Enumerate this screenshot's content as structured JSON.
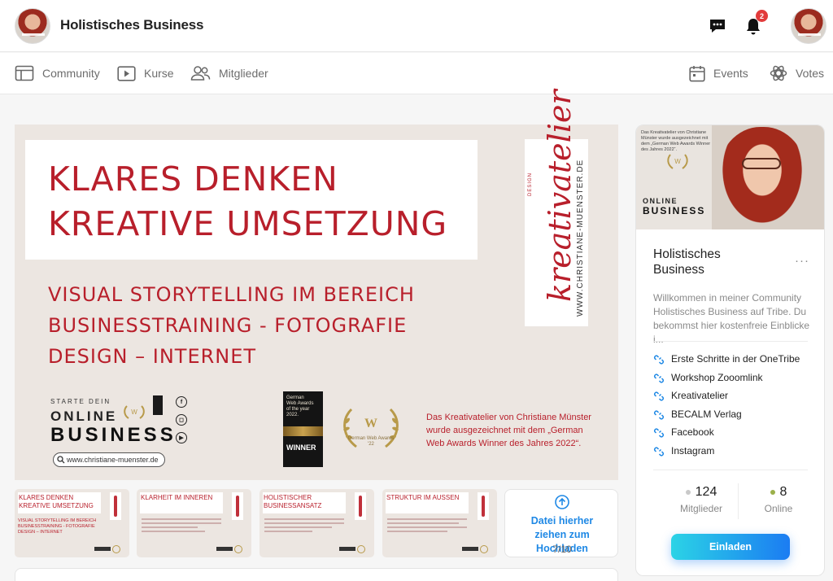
{
  "header": {
    "title": "Holistisches Business",
    "notification_count": "2",
    "icons": [
      "community-avatar",
      "chat-icon",
      "bell-icon",
      "user-avatar"
    ]
  },
  "nav": {
    "left": [
      {
        "label": "Community",
        "icon": "community-icon"
      },
      {
        "label": "Kurse",
        "icon": "play-icon"
      },
      {
        "label": "Mitglieder",
        "icon": "members-icon"
      }
    ],
    "right": [
      {
        "label": "Events",
        "icon": "calendar-icon"
      },
      {
        "label": "Votes",
        "icon": "votes-icon"
      }
    ]
  },
  "banner": {
    "title_line1": "KLARES DENKEN",
    "title_line2": "KREATIVE UMSETZUNG",
    "sub_line1": "VISUAL STORYTELLING IM BEREICH",
    "sub_line2": "BUSINESSTRAINING - FOTOGRAFIE",
    "sub_line3": "DESIGN – INTERNET",
    "logo_text": "kreativatelier",
    "logo_prefix": "DESIGN",
    "logo_url": "WWW.CHRISTIANE-MUENSTER.DE",
    "starte": "STARTE DEIN",
    "online": "ONLINE",
    "business": "BUSINESS",
    "url": "www.christiane-muenster.de",
    "gwa_line1": "German",
    "gwa_line2": "Web Awards",
    "gwa_line3": "of the year",
    "gwa_line4": "2022.",
    "gwa_winner": "WINNER",
    "laurel_label": "German Web Awards '22",
    "award_note_line1": "Das Kreativatelier von Christiane Münster",
    "award_note_line2": "wurde ausgezeichnet mit dem „German",
    "award_note_line3": "Web Awards Winner des Jahres 2022“."
  },
  "thumbnails": [
    {
      "title": "KLARES DENKEN KREATIVE UMSETZUNG",
      "sub": "VISUAL STORYTELLING IM BEREICH BUSINESSTRAINING - FOTOGRAFIE DESIGN – INTERNET"
    },
    {
      "title": "KLARHEIT IM INNEREN"
    },
    {
      "title": "HOLISTISCHER BUSINESSANSATZ"
    },
    {
      "title": "STRUKTUR IM AUSSEN"
    }
  ],
  "upload": {
    "label": "Datei hierher ziehen zum Hochladen",
    "count": "7/10"
  },
  "sidebar": {
    "name_line1": "Holistisches",
    "name_line2": "Business",
    "more": "···",
    "description": "Willkommen in meiner Community Holistisches Business auf Tribe. Du bekommst hier kostenfreie Einblicke i...",
    "image_caption": "Das Kreativatelier von Christiane Münster wurde ausgezeichnet mit dem „German Web Awards Winner des Jahres 2022“.",
    "image_online": "ONLINE",
    "image_business": "BUSINESS",
    "links": [
      {
        "label": "Erste Schritte in der OneTribe",
        "icon": "link-icon"
      },
      {
        "label": "Workshop Zooomlink",
        "icon": "link-icon"
      },
      {
        "label": "Kreativatelier",
        "icon": "link-icon"
      },
      {
        "label": "BECALM Verlag",
        "icon": "link-icon"
      },
      {
        "label": "Facebook",
        "icon": "link-icon"
      },
      {
        "label": "Instagram",
        "icon": "link-icon"
      }
    ],
    "stats": {
      "members_count": "124",
      "members_label": "Mitglieder",
      "online_count": "8",
      "online_label": "Online"
    },
    "invite_label": "Einladen"
  },
  "colors": {
    "brand_red": "#b81f2b",
    "link_blue": "#1e88e5",
    "badge_red": "#e23b3b",
    "online_green": "#9bb04a"
  }
}
